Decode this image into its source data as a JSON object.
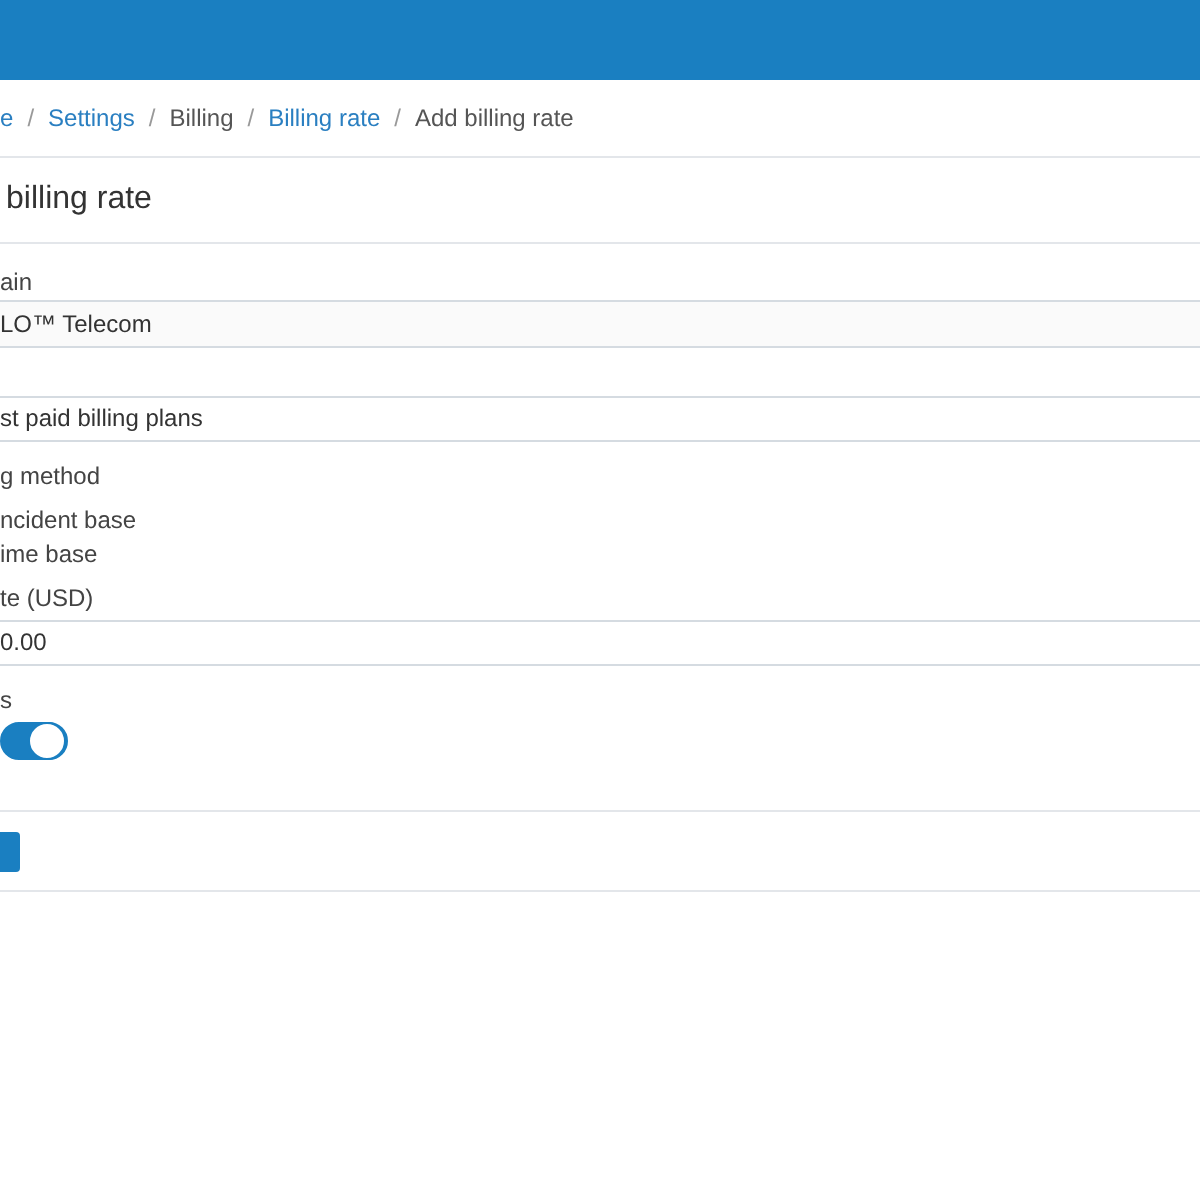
{
  "breadcrumb_separator": "/",
  "breadcrumb": [
    {
      "label": "e",
      "link": true
    },
    {
      "label": "Settings",
      "link": true
    },
    {
      "label": "Billing",
      "link": false
    },
    {
      "label": "Billing rate",
      "link": true
    },
    {
      "label": "Add billing rate",
      "link": false
    }
  ],
  "title": "billing rate",
  "domain": {
    "label": "ain",
    "value": "LO™ Telecom"
  },
  "plan": {
    "value": "st paid billing plans"
  },
  "method": {
    "label": "g method",
    "options": [
      "ncident base",
      "ime base"
    ]
  },
  "rate": {
    "label": "te (USD)",
    "value": "0.00"
  },
  "status": {
    "label": "s",
    "on": true
  }
}
